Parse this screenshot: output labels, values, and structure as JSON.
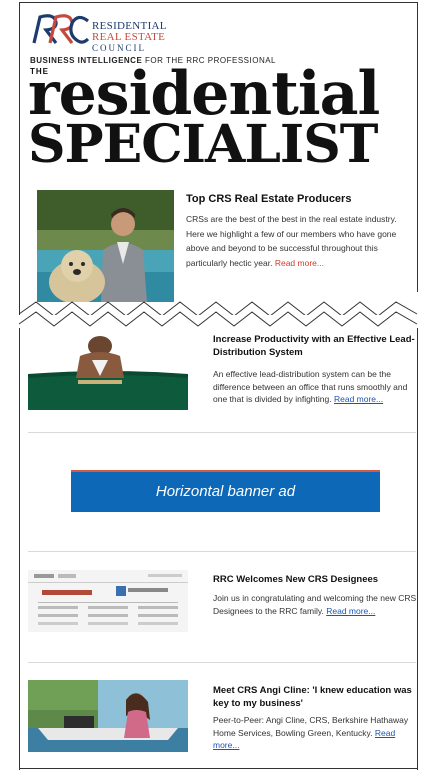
{
  "brand": {
    "org_line1": "RESIDENTIAL",
    "org_line2": "REAL ESTATE",
    "org_line3": "COUNCIL",
    "tagline_bold": "BUSINESS INTELLIGENCE",
    "tagline_rest": " FOR THE RRC PROFESSIONAL",
    "masthead_the": "THE",
    "masthead_word1": "residential",
    "masthead_word2": "SPECIALIST"
  },
  "feature": {
    "title": "Top CRS Real Estate Producers",
    "description": "CRSs are the best of the best in the real estate industry. Here we highlight a few of our members who have gone above and beyond to be successful throughout this particularly hectic year.",
    "read_more": "Read more..."
  },
  "articles": [
    {
      "title": "Increase Productivity with an Effective Lead-Distribution System",
      "description": "An effective lead-distribution system can be the difference between an office that runs smoothly and one that is divided by infighting.",
      "read_more": "Read more..."
    },
    {
      "title": "RRC Welcomes New CRS Designees",
      "description": "Join us in congratulating and welcoming the new CRS Designees to the RRC family.",
      "read_more": "Read more..."
    },
    {
      "title": "Meet CRS Angi Cline: 'I knew education was key to my business'",
      "description": "Peer-to-Peer: Angi Cline, CRS, Berkshire Hathaway Home Services, Bowling Green, Kentucky.",
      "read_more": "Read more..."
    }
  ],
  "banner": {
    "label": "Horizontal banner ad"
  },
  "colors": {
    "brand_navy": "#1d3b6f",
    "brand_red": "#c54a3e",
    "link_blue": "#1c55b3",
    "banner_blue": "#0d68b8"
  }
}
